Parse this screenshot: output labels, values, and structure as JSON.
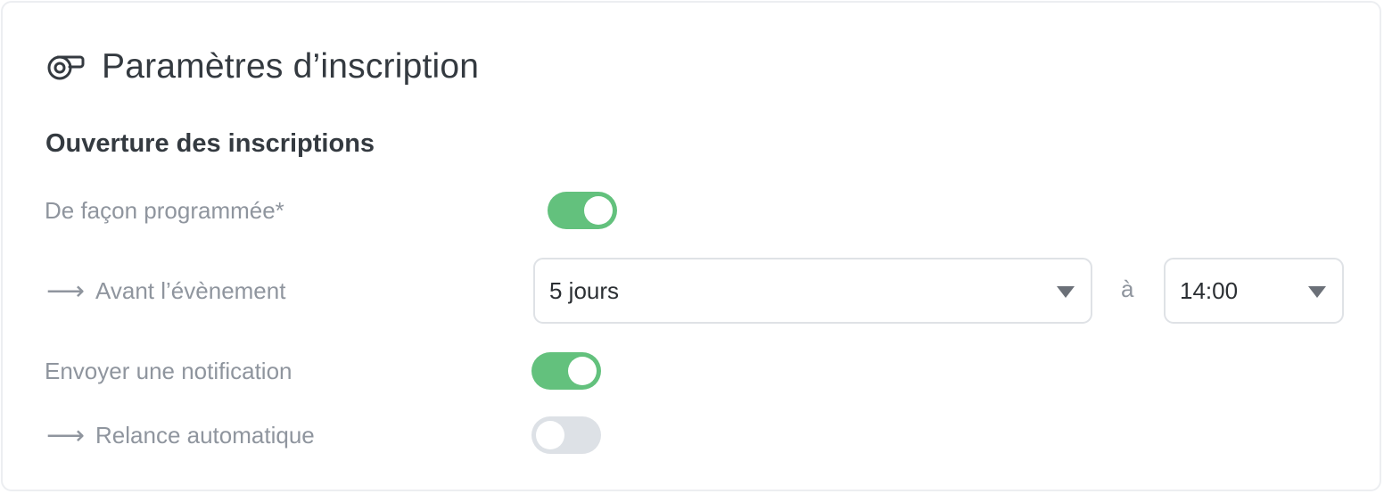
{
  "header": {
    "title": "Paramètres d’inscription",
    "icon": "ticket-icon"
  },
  "section": {
    "title": "Ouverture des inscriptions"
  },
  "rows": {
    "scheduled": {
      "label": "De façon programmée*",
      "toggle_on": true
    },
    "before_event": {
      "arrow": "⟶",
      "label": "Avant l’évènement",
      "duration_value": "5 jours",
      "separator": "à",
      "time_value": "14:00"
    },
    "notification": {
      "label": "Envoyer une notification",
      "toggle_on": true
    },
    "reminder": {
      "arrow": "⟶",
      "label": "Relance automatique",
      "toggle_on": false
    }
  },
  "colors": {
    "toggle_on": "#63c17d",
    "toggle_off": "#dde1e6",
    "text_muted": "#8f959e",
    "text_dark": "#343a40"
  }
}
